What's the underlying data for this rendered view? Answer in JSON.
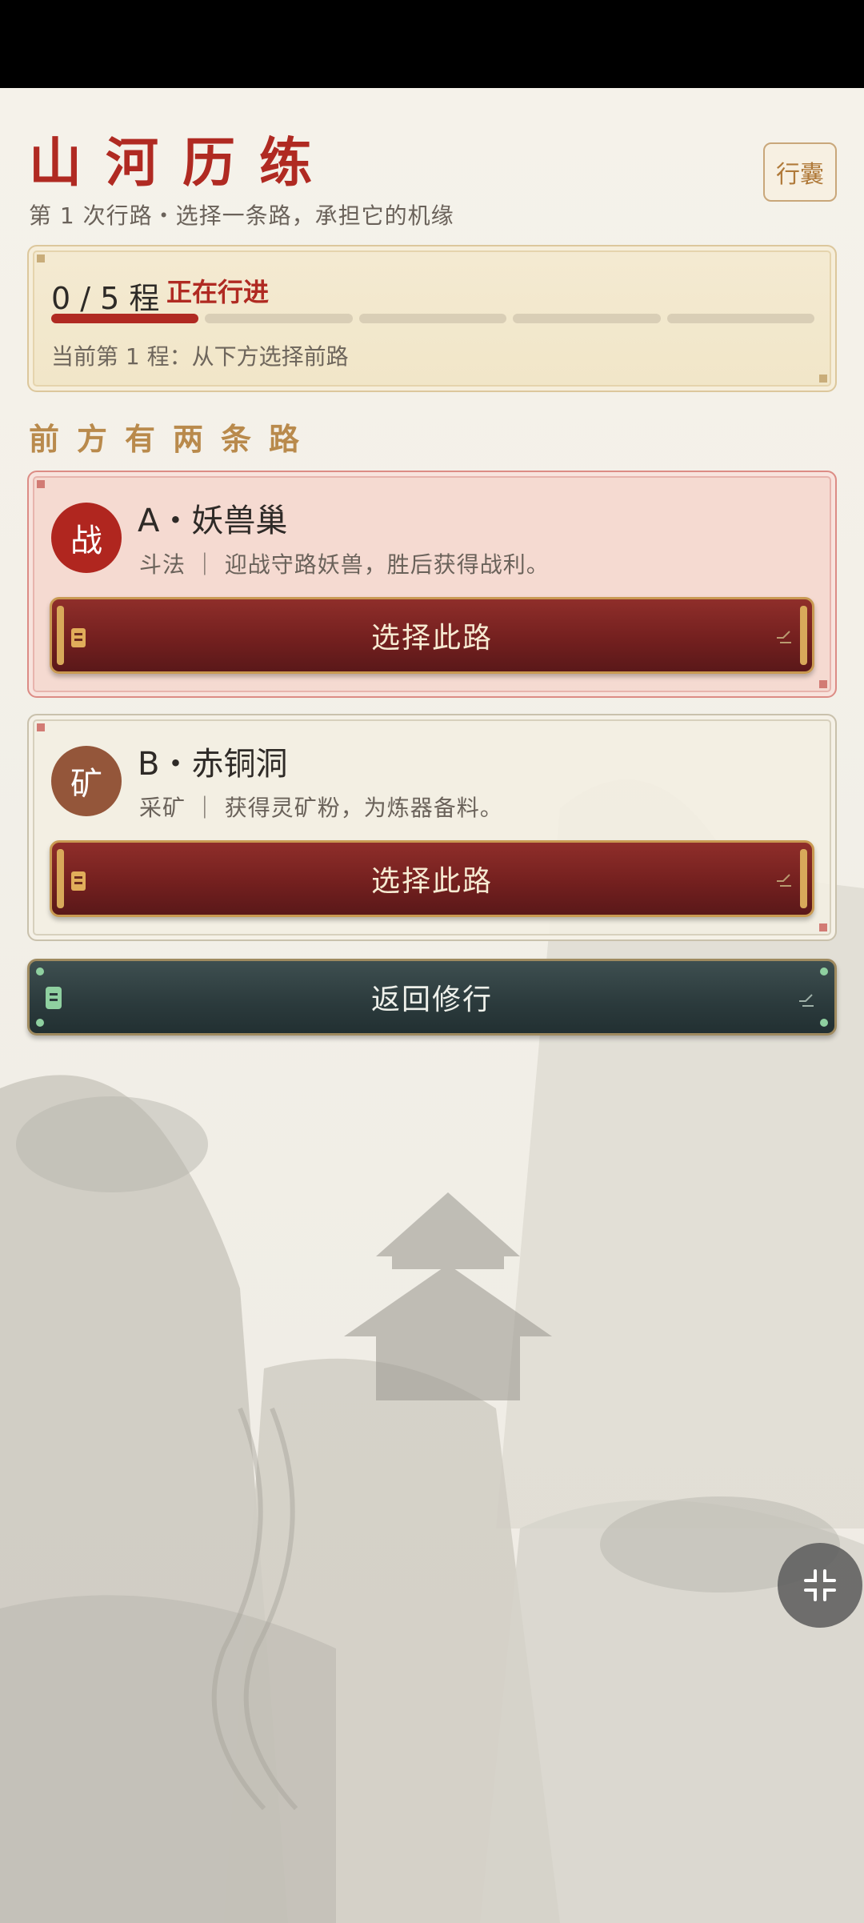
{
  "header": {
    "title": "山河历练",
    "subtitle": "第 1 次行路・选择一条路，承担它的机缘",
    "bag_button": "行囊"
  },
  "progress": {
    "count_label": "0 / 5 程",
    "status": "正在行进",
    "current": 0,
    "total": 5,
    "note": "当前第 1 程：从下方选择前路"
  },
  "section": {
    "title": "前方有两条路"
  },
  "paths": [
    {
      "avatar": "战",
      "name": "A・妖兽巢",
      "desc": "斗法 ｜ 迎战守路妖兽，胜后获得战利。",
      "button": "选择此路"
    },
    {
      "avatar": "矿",
      "name": "B・赤铜洞",
      "desc": "采矿 ｜ 获得灵矿粉，为炼器备料。",
      "button": "选择此路"
    }
  ],
  "return_button": "返回修行",
  "icons": {
    "scroll": "scroll-icon",
    "deco": "corner-deco-icon",
    "badge": "badge-icon",
    "collapse": "collapse-icon"
  },
  "colors": {
    "accent_red": "#b02a22",
    "gold": "#c99a52",
    "teal": "#2b3a3c"
  }
}
